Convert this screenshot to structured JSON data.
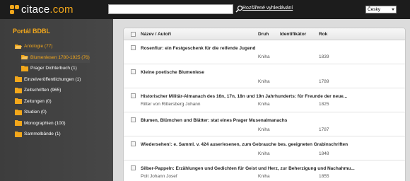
{
  "header": {
    "logo_text": "citace",
    "logo_suffix": ".com",
    "search_value": "",
    "search_placeholder": "",
    "advanced_search_label": "Rozšířené vyhledávání",
    "language": "Česky",
    "accent_color": "#f2a71b"
  },
  "sidebar": {
    "title": "Portál BDBL",
    "items": [
      {
        "label": "Antologie (77)"
      },
      {
        "label": "Blumenlesen 1780-1925 (76)"
      },
      {
        "label": "Prager Dichterbuch (1)"
      },
      {
        "label": "Einzelveröffentlichungen (1)"
      },
      {
        "label": "Zeitschriften (965)"
      },
      {
        "label": "Zeitungen (0)"
      },
      {
        "label": "Studien (0)"
      },
      {
        "label": "Monographien (100)"
      },
      {
        "label": "Sammelbände (1)"
      }
    ]
  },
  "table": {
    "columns": {
      "name": "Název / Autoři",
      "type": "Druh",
      "id": "Identifikátor",
      "year": "Rok"
    },
    "rows": [
      {
        "title": "Rosenflur: ein Festgeschenk für die reifende Jugend",
        "author": "",
        "type": "Kniha",
        "year": "1839"
      },
      {
        "title": "Kleine poetische Blumenlese",
        "author": "",
        "type": "Kniha",
        "year": "1789"
      },
      {
        "title": "Historischer Militär-Almanach des 16n, 17n, 18n und 19n Jahrhunderts: für Freunde der neue...",
        "author": "Ritter von Rittersberg Johann",
        "type": "Kniha",
        "year": "1825"
      },
      {
        "title": "Blumen, Blümchen und Blätter: stat eines Prager Musenalmanachs",
        "author": "",
        "type": "Kniha",
        "year": "1787"
      },
      {
        "title": "Wiedersehen!: e. Samml. v. 424 auserlesenen, zum Gebrauche bes. geeigneten Grabinschriften",
        "author": "",
        "type": "Kniha",
        "year": "1848"
      },
      {
        "title": "Silber-Pappeln: Erzählungen und Gedichten für Geist und Herz, zur Beherzigung und Nachahmu...",
        "author": "Polt Johann Josef",
        "type": "Kniha",
        "year": "1855"
      }
    ]
  }
}
